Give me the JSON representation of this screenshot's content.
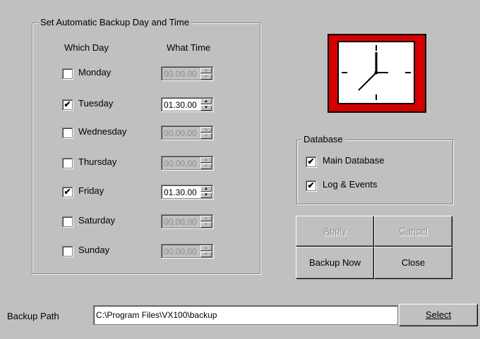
{
  "schedule_group": {
    "title": "Set Automatic Backup Day and Time",
    "col_day": "Which Day",
    "col_time": "What Time",
    "days": [
      {
        "label": "Monday",
        "checked": false,
        "time": "00.00.00"
      },
      {
        "label": "Tuesday",
        "checked": true,
        "time": "01.30.00"
      },
      {
        "label": "Wednesday",
        "checked": false,
        "time": "00.00.00"
      },
      {
        "label": "Thursday",
        "checked": false,
        "time": "00.00.00"
      },
      {
        "label": "Friday",
        "checked": true,
        "time": "01.30.00"
      },
      {
        "label": "Saturday",
        "checked": false,
        "time": "00.00.00"
      },
      {
        "label": "Sunday",
        "checked": false,
        "time": "00.00.00"
      }
    ]
  },
  "database_group": {
    "title": "Database",
    "items": [
      {
        "label": "Main Database",
        "checked": true
      },
      {
        "label": "Log & Events",
        "checked": true
      }
    ]
  },
  "buttons": {
    "apply": "Apply",
    "cancel": "Cancel",
    "backup_now": "Backup Now",
    "close": "Close",
    "select": "Select"
  },
  "backup_path": {
    "label": "Backup Path",
    "value": "C:\\Program Files\\VX100\\backup"
  },
  "icons": {
    "clock": "clock-icon",
    "check": "checkmark-icon",
    "spin_up": "spin-up-icon",
    "spin_down": "spin-down-icon"
  },
  "colors": {
    "window_bg": "#c0c0c0",
    "clock_frame": "#d40000",
    "disabled_text": "#8c8c8c"
  }
}
